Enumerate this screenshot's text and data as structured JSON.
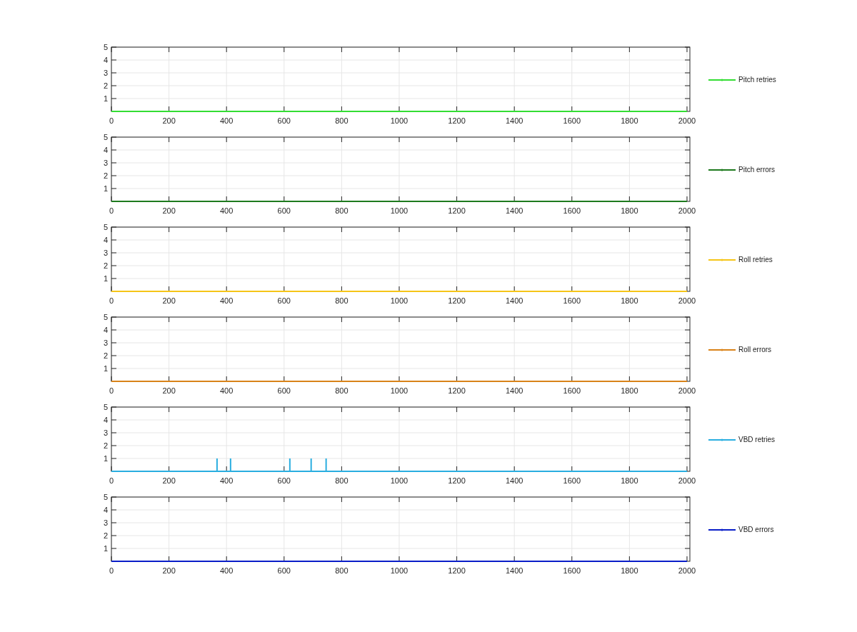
{
  "charts": [
    {
      "chart_data": {
        "type": "line",
        "x": [
          0,
          2000
        ],
        "series": [
          {
            "name": "Pitch retries",
            "color": "#33dd33",
            "values": [
              0,
              0
            ]
          }
        ],
        "xlim": [
          0,
          2010
        ],
        "ylim": [
          0,
          5
        ],
        "xticks": [
          0,
          200,
          400,
          600,
          800,
          1000,
          1200,
          1400,
          1600,
          1800,
          2000
        ],
        "yticks": [
          1,
          2,
          3,
          4,
          5
        ],
        "grid": true
      }
    },
    {
      "chart_data": {
        "type": "line",
        "x": [
          0,
          2000
        ],
        "series": [
          {
            "name": "Pitch errors",
            "color": "#1e7a1e",
            "values": [
              0,
              0
            ]
          }
        ],
        "xlim": [
          0,
          2010
        ],
        "ylim": [
          0,
          5
        ],
        "xticks": [
          0,
          200,
          400,
          600,
          800,
          1000,
          1200,
          1400,
          1600,
          1800,
          2000
        ],
        "yticks": [
          1,
          2,
          3,
          4,
          5
        ],
        "grid": true
      }
    },
    {
      "chart_data": {
        "type": "line",
        "x": [
          0,
          2000
        ],
        "series": [
          {
            "name": "Roll retries",
            "color": "#f5c518",
            "values": [
              0,
              0
            ]
          }
        ],
        "xlim": [
          0,
          2010
        ],
        "ylim": [
          0,
          5
        ],
        "xticks": [
          0,
          200,
          400,
          600,
          800,
          1000,
          1200,
          1400,
          1600,
          1800,
          2000
        ],
        "yticks": [
          1,
          2,
          3,
          4,
          5
        ],
        "grid": true
      }
    },
    {
      "chart_data": {
        "type": "line",
        "x": [
          0,
          2000
        ],
        "series": [
          {
            "name": "Roll errors",
            "color": "#d98319",
            "values": [
              0,
              0
            ]
          }
        ],
        "xlim": [
          0,
          2010
        ],
        "ylim": [
          0,
          5
        ],
        "xticks": [
          0,
          200,
          400,
          600,
          800,
          1000,
          1200,
          1400,
          1600,
          1800,
          2000
        ],
        "yticks": [
          1,
          2,
          3,
          4,
          5
        ],
        "grid": true
      }
    },
    {
      "chart_data": {
        "type": "line",
        "x": [
          0,
          367,
          367,
          367,
          414,
          414,
          414,
          620,
          620,
          620,
          694,
          694,
          694,
          746,
          746,
          746,
          2000
        ],
        "series": [
          {
            "name": "VBD retries",
            "color": "#2aaee0",
            "values": [
              0,
              0,
              1,
              0,
              0,
              1,
              0,
              0,
              1,
              0,
              0,
              1,
              0,
              0,
              1,
              0,
              0
            ]
          }
        ],
        "xlim": [
          0,
          2010
        ],
        "ylim": [
          0,
          5
        ],
        "xticks": [
          0,
          200,
          400,
          600,
          800,
          1000,
          1200,
          1400,
          1600,
          1800,
          2000
        ],
        "yticks": [
          1,
          2,
          3,
          4,
          5
        ],
        "grid": true
      }
    },
    {
      "chart_data": {
        "type": "line",
        "x": [
          0,
          2000
        ],
        "series": [
          {
            "name": "VBD errors",
            "color": "#0a1ec8",
            "values": [
              0,
              0
            ]
          }
        ],
        "xlim": [
          0,
          2010
        ],
        "ylim": [
          0,
          5
        ],
        "xticks": [
          0,
          200,
          400,
          600,
          800,
          1000,
          1200,
          1400,
          1600,
          1800,
          2000
        ],
        "yticks": [
          1,
          2,
          3,
          4,
          5
        ],
        "grid": true
      }
    }
  ]
}
